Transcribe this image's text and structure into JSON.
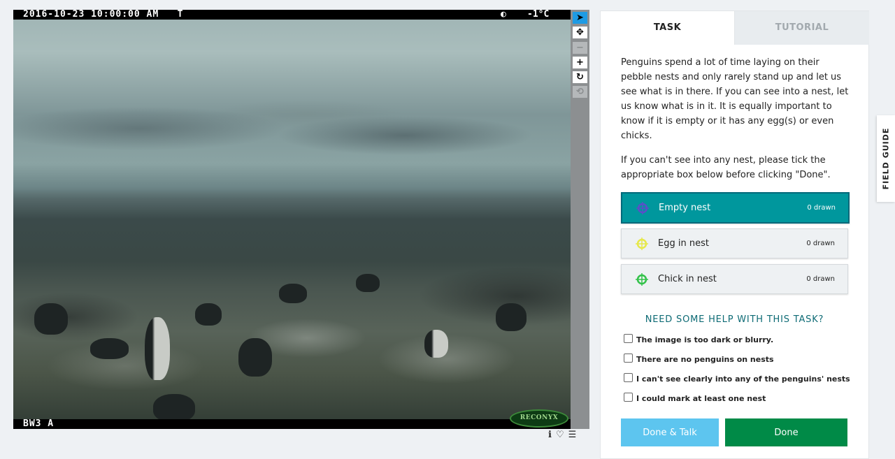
{
  "image": {
    "timestamp": "2016-10-23 10:00:00 AM",
    "temp_flag": "T",
    "moon_glyph": "◐",
    "temperature": "-1°C",
    "camera_id": "BW3 A",
    "logo": "RECONYX"
  },
  "tools": [
    {
      "name": "pointer-icon",
      "glyph": "➤"
    },
    {
      "name": "move-icon",
      "glyph": "✥"
    },
    {
      "name": "zoom-out-icon",
      "glyph": "−"
    },
    {
      "name": "zoom-in-icon",
      "glyph": "+"
    },
    {
      "name": "rotate-icon",
      "glyph": "↻"
    },
    {
      "name": "reset-icon",
      "glyph": "⟲"
    }
  ],
  "image_actions": {
    "info": "ℹ",
    "favorite": "♡",
    "collections": "☰"
  },
  "tabs": {
    "task": "TASK",
    "tutorial": "TUTORIAL"
  },
  "instructions": {
    "p1": "Penguins spend a lot of time laying on their pebble nests and only rarely stand up and let us see what is in there. If you can see into a nest, let us know what is in it. It is equally important to know if it is empty or it has any egg(s) or even chicks.",
    "p2": "If you can't see into any nest, please tick the appropriate box below before clicking \"Done\"."
  },
  "choices": [
    {
      "label": "Empty nest",
      "count": "0 drawn",
      "color": "#5b4fc9",
      "selected": true
    },
    {
      "label": "Egg in nest",
      "count": "0 drawn",
      "color": "#e6e84a",
      "selected": false
    },
    {
      "label": "Chick in nest",
      "count": "0 drawn",
      "color": "#33c24a",
      "selected": false
    }
  ],
  "help": {
    "title": "NEED SOME HELP WITH THIS TASK?",
    "checks": [
      "The image is too dark or blurry.",
      "There are no penguins on nests",
      "I can't see clearly into any of the penguins' nests",
      "I could mark at least one nest"
    ]
  },
  "buttons": {
    "done_talk": "Done & Talk",
    "done": "Done"
  },
  "field_guide": "FIELD GUIDE"
}
